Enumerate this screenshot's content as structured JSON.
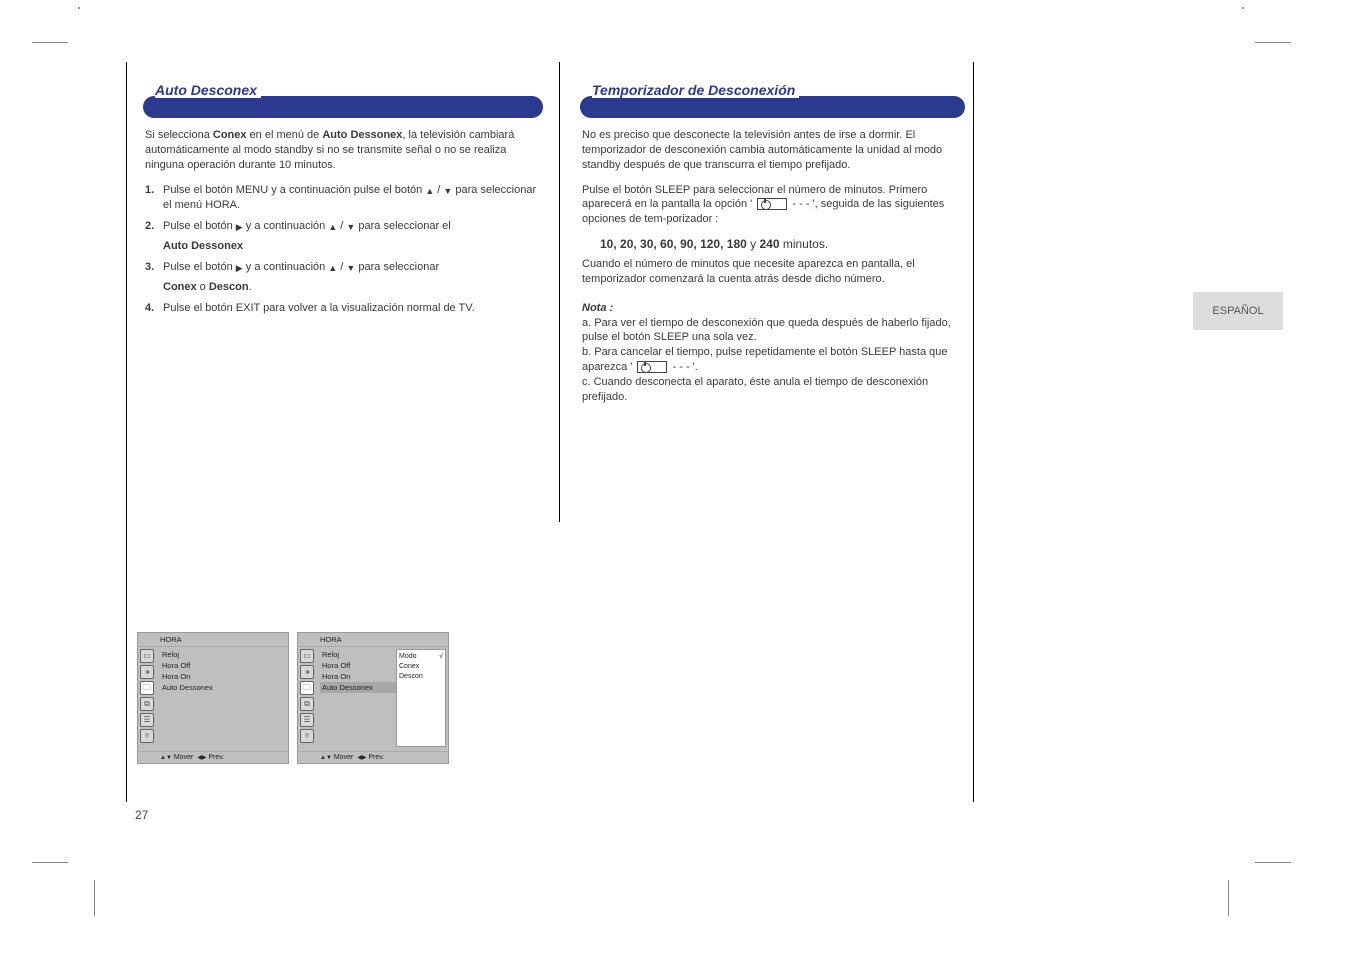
{
  "page_number": "27",
  "side_tab": "ESPAÑOL",
  "left": {
    "section_title": "Auto Desconex",
    "intro_a": "Si selecciona ",
    "intro_b": " en el menú de ",
    "intro_c": ", la televisión cambiará automáticamente al modo standby si no se transmite señal o no se realiza ninguna operación durante 10 minutos.",
    "bold1": "Conex",
    "bold2": "Auto Dessonex",
    "step1_a": "Pulse el botón MENU y a continuación pulse el botón ",
    "step1_b": " / ",
    "step1_c": " para seleccionar el menú ",
    "step1_d": "HORA",
    "step2_a": "Pulse el botón ",
    "step2_b": " y a continuación ",
    "step2_c": " / ",
    "step2_d": " para seleccionar el ",
    "step2_bold": "Auto Dessonex",
    "step3_a": "Pulse el botón ",
    "step3_b": " y a continuación ",
    "step3_c": " / ",
    "step3_d": " para seleccionar ",
    "step3_bold_a": "Conex",
    "step3_mid": " o ",
    "step3_bold_b": "Descon",
    "step4": "Pulse el botón EXIT para volver a la visualización normal de TV."
  },
  "right": {
    "section_title": "Temporizador de Desconexión",
    "p1": "No es preciso que desconecte la televisión antes de irse a dormir. El temporizador de desconexión cambia automáticamente la unidad al modo standby después de que transcurra el tiempo prefijado.",
    "p2_a": "Pulse el botón SLEEP para seleccionar el número de minutos. Primero aparecerá en la pantalla la opción ' ",
    "p2_b": " - - - ', seguida de las siguientes opciones de tem-porizador : ",
    "times": "10, 20, 30, 60, 90, 120, 180",
    "times_tail": " y ",
    "times_last": "240",
    "p2_c": " minutos.",
    "p3": "Cuando el número de minutos que necesite aparezca en pantalla, el temporizador comenzará la cuenta atrás desde dicho número.",
    "notes_title_a": "Nota :",
    "note_a_1": "a. Para ver el tiempo de desconexión que queda después de haberlo fijado, pulse el botón SLEEP una sola vez.",
    "note_a_2_a": "b. Para cancelar el tiempo, pulse repetidamente el botón SLEEP hasta que aparezca ' ",
    "note_a_2_b": " - - - '.",
    "note_a_3": "c. Cuando desconecta el aparato, éste anula el tiempo de desconexión prefijado."
  },
  "osd": {
    "header": "HORA",
    "items": [
      "Reloj",
      "Hora Off",
      "Hora On",
      "Auto Dessonex"
    ],
    "footer_a": "Mover",
    "footer_b": "Prev.",
    "footer_sym1": "▲▼",
    "footer_sym2": "◀▶",
    "detail_label": "Modo",
    "detail_check": "√",
    "detail_opts": [
      "Conex",
      "Descon"
    ]
  },
  "icons": [
    "▭",
    "🕩",
    "🗀",
    "⧉",
    "☰",
    "⌾"
  ]
}
